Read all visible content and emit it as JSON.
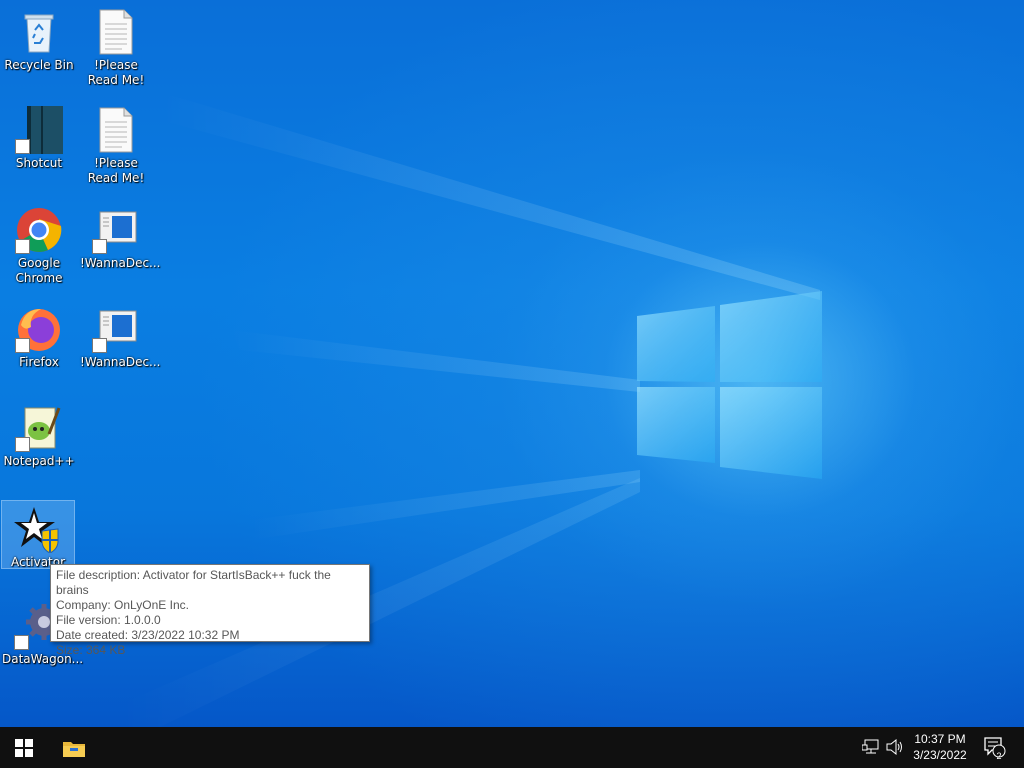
{
  "desktop": {
    "icons": [
      {
        "label": "Recycle Bin",
        "icon": "recycle-bin-icon"
      },
      {
        "label": "!Please Read Me!",
        "icon": "text-document-icon"
      },
      {
        "label": "Shotcut",
        "icon": "shotcut-icon"
      },
      {
        "label": "!Please Read Me!",
        "icon": "text-document-icon"
      },
      {
        "label": "Google Chrome",
        "icon": "chrome-icon"
      },
      {
        "label": "!WannaDec...",
        "icon": "wannadecryptor-icon"
      },
      {
        "label": "Firefox",
        "icon": "firefox-icon"
      },
      {
        "label": "!WannaDec...",
        "icon": "wannadecryptor-icon"
      },
      {
        "label": "Notepad++",
        "icon": "notepadpp-icon"
      },
      {
        "label": "Activator",
        "icon": "activator-icon"
      },
      {
        "label": "DataWagon...",
        "icon": "gear-icon"
      }
    ]
  },
  "tooltip": {
    "lines": [
      "File description: Activator for StartIsBack++ fuck the brains",
      "Company: OnLyOnE Inc.",
      "File version: 1.0.0.0",
      "Date created: 3/23/2022 10:32 PM",
      "Size: 364 KB"
    ]
  },
  "taskbar": {
    "start_icon": "windows-logo-icon",
    "pinned": [
      {
        "name": "File Explorer",
        "icon": "folder-icon"
      }
    ],
    "tray": {
      "network_icon": "network-icon",
      "volume_icon": "volume-icon",
      "time": "10:37 PM",
      "date": "3/23/2022",
      "notification_count": "2"
    }
  },
  "colors": {
    "desktop_blue": "#0a78e0",
    "taskbar": "#101010",
    "selection": "#b4dcff"
  }
}
